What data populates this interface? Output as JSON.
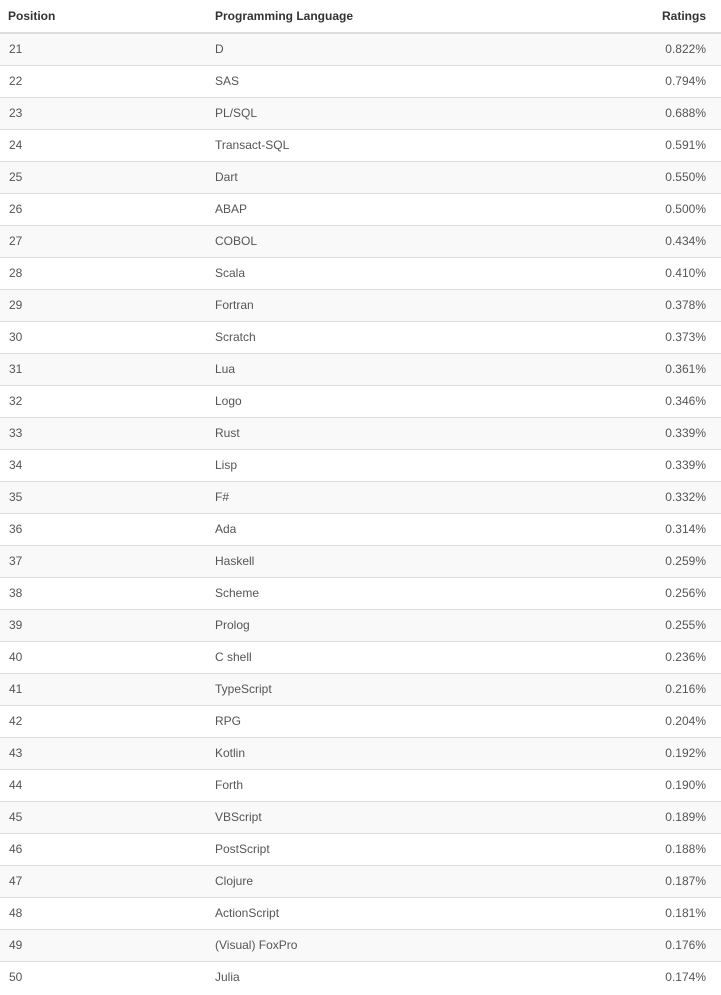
{
  "table": {
    "headers": {
      "position": "Position",
      "language": "Programming Language",
      "ratings": "Ratings"
    },
    "rows": [
      {
        "position": "21",
        "language": "D",
        "rating": "0.822%"
      },
      {
        "position": "22",
        "language": "SAS",
        "rating": "0.794%"
      },
      {
        "position": "23",
        "language": "PL/SQL",
        "rating": "0.688%"
      },
      {
        "position": "24",
        "language": "Transact-SQL",
        "rating": "0.591%"
      },
      {
        "position": "25",
        "language": "Dart",
        "rating": "0.550%"
      },
      {
        "position": "26",
        "language": "ABAP",
        "rating": "0.500%"
      },
      {
        "position": "27",
        "language": "COBOL",
        "rating": "0.434%"
      },
      {
        "position": "28",
        "language": "Scala",
        "rating": "0.410%"
      },
      {
        "position": "29",
        "language": "Fortran",
        "rating": "0.378%"
      },
      {
        "position": "30",
        "language": "Scratch",
        "rating": "0.373%"
      },
      {
        "position": "31",
        "language": "Lua",
        "rating": "0.361%"
      },
      {
        "position": "32",
        "language": "Logo",
        "rating": "0.346%"
      },
      {
        "position": "33",
        "language": "Rust",
        "rating": "0.339%"
      },
      {
        "position": "34",
        "language": "Lisp",
        "rating": "0.339%"
      },
      {
        "position": "35",
        "language": "F#",
        "rating": "0.332%"
      },
      {
        "position": "36",
        "language": "Ada",
        "rating": "0.314%"
      },
      {
        "position": "37",
        "language": "Haskell",
        "rating": "0.259%"
      },
      {
        "position": "38",
        "language": "Scheme",
        "rating": "0.256%"
      },
      {
        "position": "39",
        "language": "Prolog",
        "rating": "0.255%"
      },
      {
        "position": "40",
        "language": "C shell",
        "rating": "0.236%"
      },
      {
        "position": "41",
        "language": "TypeScript",
        "rating": "0.216%"
      },
      {
        "position": "42",
        "language": "RPG",
        "rating": "0.204%"
      },
      {
        "position": "43",
        "language": "Kotlin",
        "rating": "0.192%"
      },
      {
        "position": "44",
        "language": "Forth",
        "rating": "0.190%"
      },
      {
        "position": "45",
        "language": "VBScript",
        "rating": "0.189%"
      },
      {
        "position": "46",
        "language": "PostScript",
        "rating": "0.188%"
      },
      {
        "position": "47",
        "language": "Clojure",
        "rating": "0.187%"
      },
      {
        "position": "48",
        "language": "ActionScript",
        "rating": "0.181%"
      },
      {
        "position": "49",
        "language": "(Visual) FoxPro",
        "rating": "0.176%"
      },
      {
        "position": "50",
        "language": "Julia",
        "rating": "0.174%"
      }
    ]
  }
}
